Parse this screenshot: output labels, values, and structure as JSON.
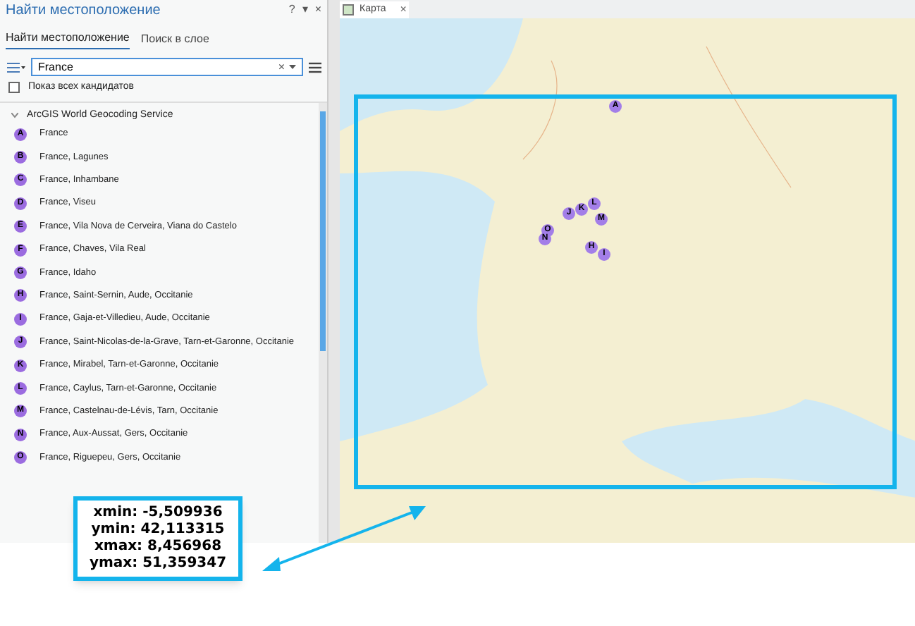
{
  "pane": {
    "title": "Найти местоположение",
    "controls": [
      "?",
      "▾",
      "×"
    ]
  },
  "tabs": [
    {
      "label": "Найти местоположение",
      "selected": true
    },
    {
      "label": "Поиск в слое",
      "selected": false
    }
  ],
  "search": {
    "value": "France",
    "clear": "×"
  },
  "show_all": {
    "label": "Показ всех кандидатов",
    "checked": false
  },
  "group": {
    "label": "ArcGIS World Geocoding Service",
    "expanded": true
  },
  "results": [
    {
      "letter": "A",
      "text": "France"
    },
    {
      "letter": "B",
      "text": "France, Lagunes"
    },
    {
      "letter": "C",
      "text": "France, Inhambane"
    },
    {
      "letter": "D",
      "text": "France, Viseu"
    },
    {
      "letter": "E",
      "text": "France, Vila Nova de Cerveira, Viana do Castelo"
    },
    {
      "letter": "F",
      "text": "France, Chaves, Vila Real"
    },
    {
      "letter": "G",
      "text": "France, Idaho"
    },
    {
      "letter": "H",
      "text": "France, Saint-Sernin, Aude, Occitanie"
    },
    {
      "letter": "I",
      "text": "France, Gaja-et-Villedieu, Aude, Occitanie"
    },
    {
      "letter": "J",
      "text": "France, Saint-Nicolas-de-la-Grave, Tarn-et-Garonne, Occitanie"
    },
    {
      "letter": "K",
      "text": "France, Mirabel, Tarn-et-Garonne, Occitanie"
    },
    {
      "letter": "L",
      "text": "France, Caylus, Tarn-et-Garonne, Occitanie"
    },
    {
      "letter": "M",
      "text": "France, Castelnau-de-Lévis, Tarn, Occitanie"
    },
    {
      "letter": "N",
      "text": "France, Aux-Aussat, Gers, Occitanie"
    },
    {
      "letter": "O",
      "text": "France, Riguepeu, Gers, Occitanie"
    }
  ],
  "map_tab": {
    "label": "Карта",
    "close": "×"
  },
  "map_markers": [
    "A",
    "J",
    "K",
    "L",
    "M",
    "O",
    "N",
    "H",
    "I"
  ],
  "extent": [
    "xmin: -5,509936",
    "ymin: 42,113315",
    "xmax: 8,456968",
    "ymax: 51,359347"
  ]
}
